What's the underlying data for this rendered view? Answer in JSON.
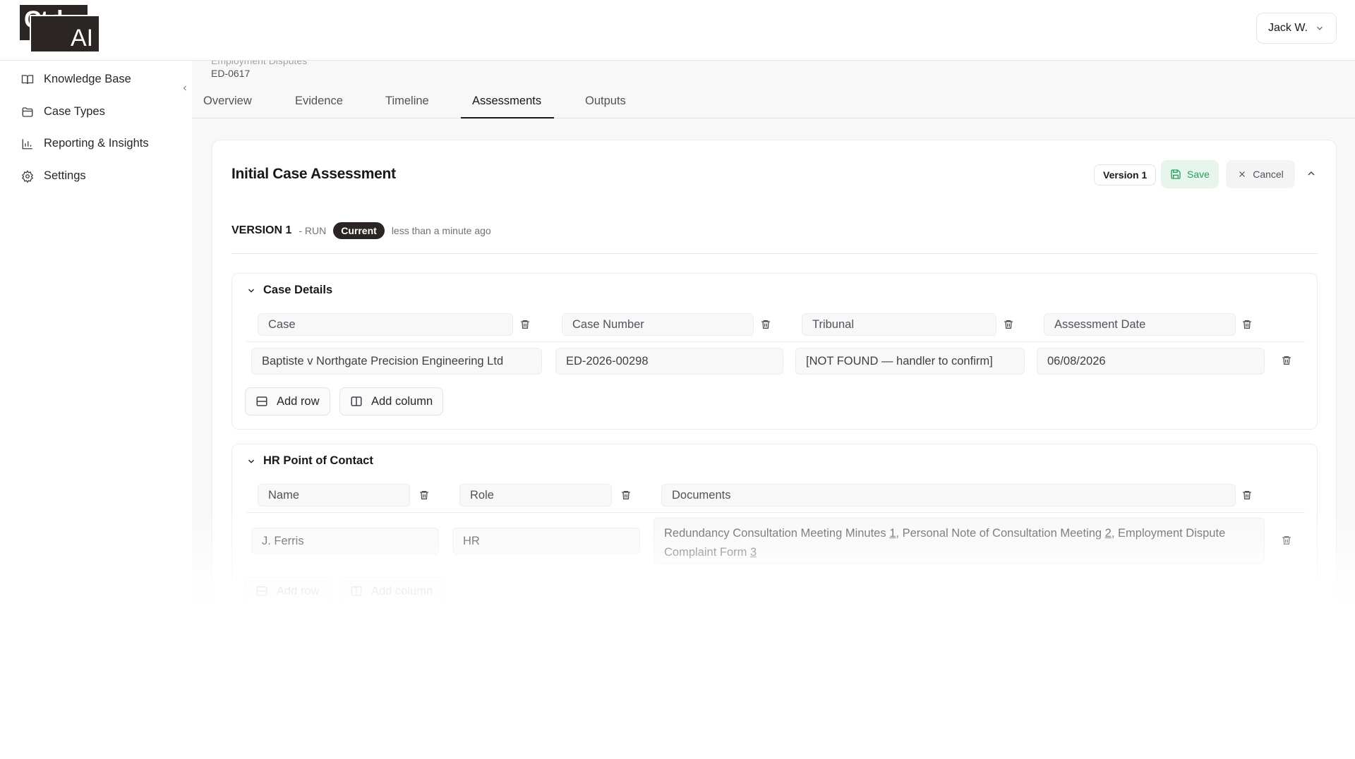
{
  "app": {
    "logo_line1": "Ctrl",
    "logo_line2": "AI",
    "user_name": "Jack W."
  },
  "sidebar": {
    "items": [
      {
        "label": "Knowledge Base",
        "icon": "book-icon"
      },
      {
        "label": "Case Types",
        "icon": "folder-icon"
      },
      {
        "label": "Reporting & Insights",
        "icon": "bar-chart-icon"
      },
      {
        "label": "Settings",
        "icon": "gear-icon"
      }
    ]
  },
  "case": {
    "type_label": "Employment Disputes",
    "id": "ED-0617"
  },
  "tabs": [
    {
      "label": "Overview"
    },
    {
      "label": "Evidence"
    },
    {
      "label": "Timeline"
    },
    {
      "label": "Assessments",
      "active": true
    },
    {
      "label": "Outputs"
    }
  ],
  "assessment": {
    "title": "Initial Case Assessment",
    "version_badge": "Version 1",
    "save_label": "Save",
    "cancel_label": "Cancel",
    "version_label": "VERSION 1",
    "run_label": "- RUN",
    "current_label": "Current",
    "time_ago": "less than a minute ago"
  },
  "sections": [
    {
      "title": "Case Details",
      "columns": [
        "Case",
        "Case Number",
        "Tribunal",
        "Assessment Date"
      ],
      "rows": [
        [
          "Baptiste v Northgate Precision Engineering Ltd",
          "ED-2026-00298",
          "[NOT FOUND — handler to confirm]",
          "06/08/2026"
        ]
      ],
      "add_row_label": "Add row",
      "add_column_label": "Add column"
    },
    {
      "title": "HR Point of Contact",
      "columns": [
        "Name",
        "Role",
        "Documents"
      ],
      "rows": [
        {
          "name": "J. Ferris",
          "role": "HR",
          "documents": [
            {
              "text": "Redundancy Consultation Meeting Minutes",
              "ref": "1"
            },
            {
              "text": "Personal Note of Consultation Meeting",
              "ref": "2"
            },
            {
              "text": "Employment Dispute Complaint Form",
              "ref": "3"
            }
          ]
        }
      ],
      "add_row_label": "Add row",
      "add_column_label": "Add column"
    }
  ],
  "colors": {
    "accent_dark": "#2b2623",
    "save_green": "#22a35a",
    "save_bg": "#e8f5ec"
  }
}
